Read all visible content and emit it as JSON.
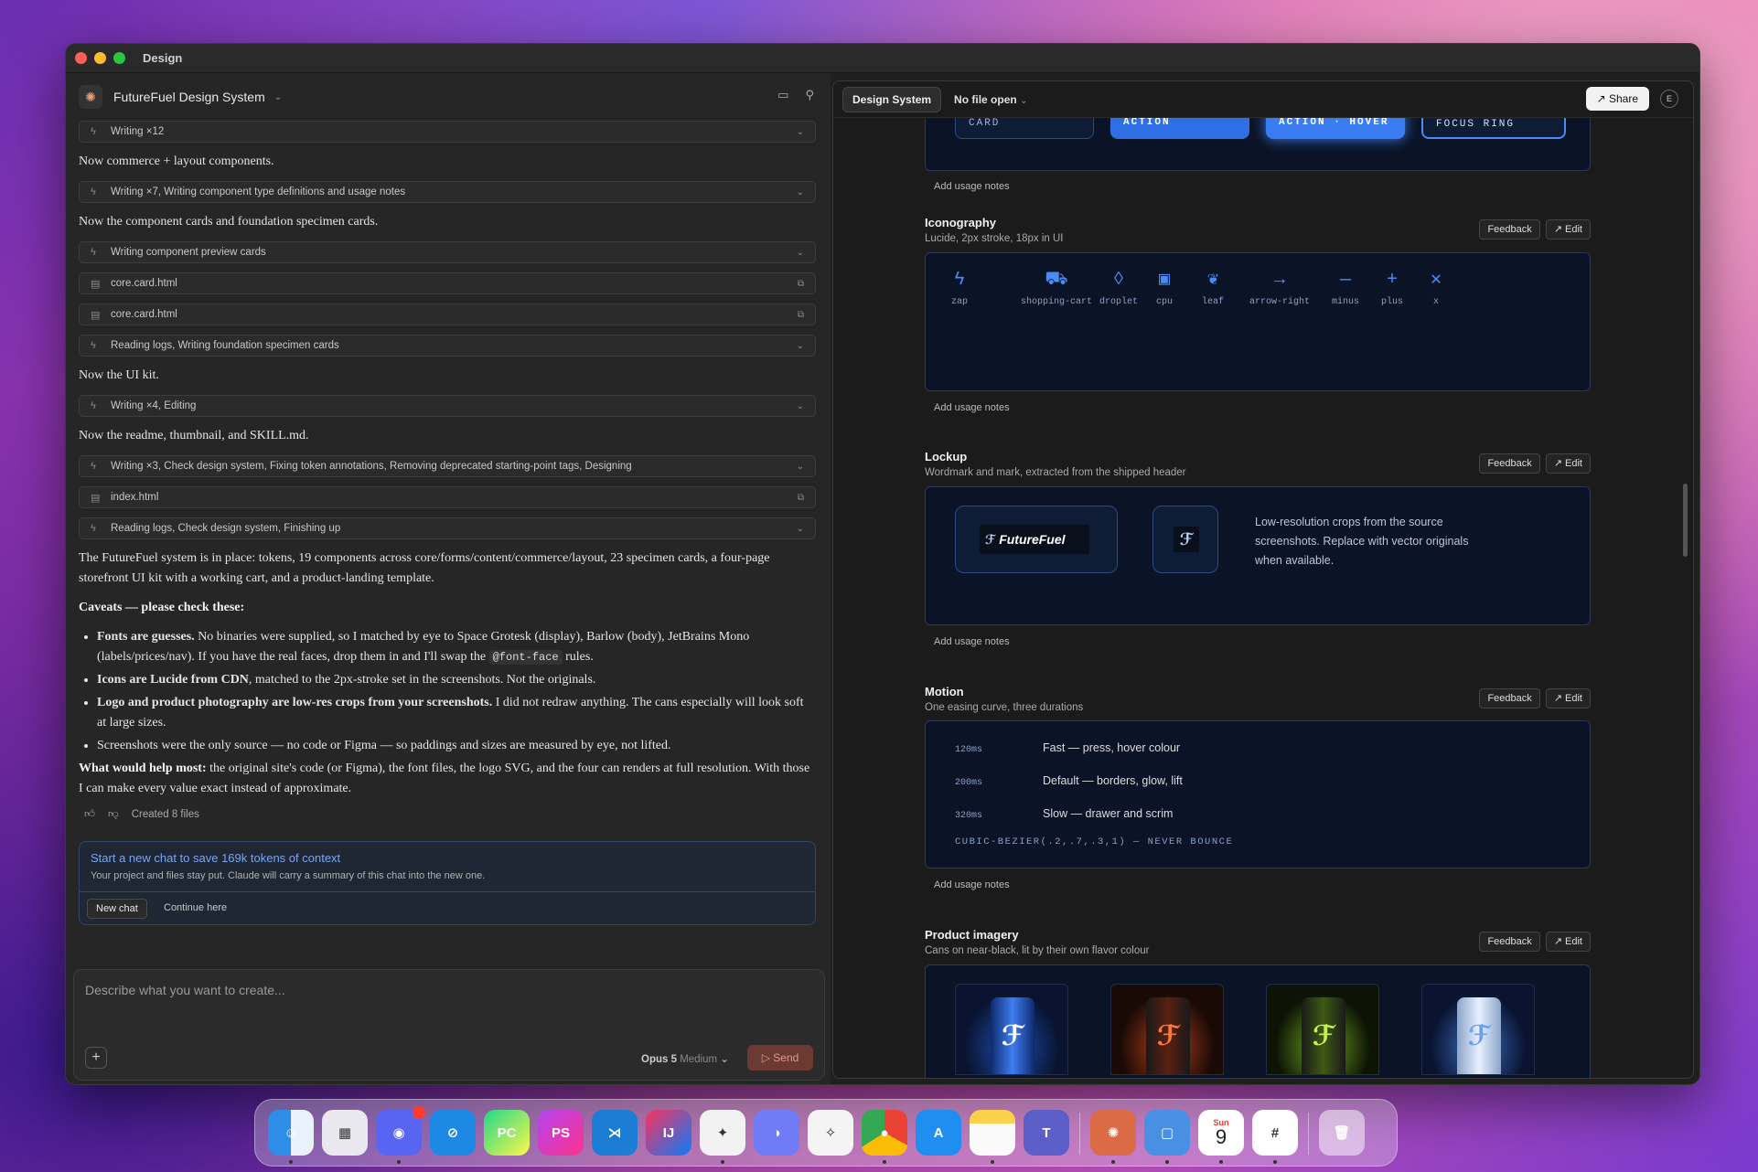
{
  "window_title": "Design",
  "project": {
    "name": "FutureFuel Design System"
  },
  "chat_items": [
    {
      "kind": "tool",
      "text": "Writing ×12"
    },
    {
      "kind": "msg",
      "text": "Now commerce + layout components."
    },
    {
      "kind": "tool",
      "text": "Writing ×7, Writing component type definitions and usage notes"
    },
    {
      "kind": "msg",
      "text": "Now the component cards and foundation specimen cards."
    },
    {
      "kind": "tool",
      "text": "Writing component preview cards"
    },
    {
      "kind": "file",
      "text": "core.card.html"
    },
    {
      "kind": "file",
      "text": "core.card.html"
    },
    {
      "kind": "tool",
      "text": "Reading logs, Writing foundation specimen cards"
    },
    {
      "kind": "msg",
      "text": "Now the UI kit."
    },
    {
      "kind": "tool",
      "text": "Writing ×4, Editing"
    },
    {
      "kind": "msg",
      "text": "Now the readme, thumbnail, and SKILL.md."
    },
    {
      "kind": "tool",
      "text": "Writing ×3, Check design system, Fixing token annotations, Removing deprecated starting-point tags, Designing"
    },
    {
      "kind": "file",
      "text": "index.html"
    },
    {
      "kind": "tool",
      "text": "Reading logs, Check design system, Finishing up"
    }
  ],
  "summary": {
    "para1": "The FutureFuel system is in place: tokens, 19 components across core/forms/content/commerce/layout, 23 specimen cards, a four-page storefront UI kit with a working cart, and a product-landing template.",
    "caveats_title": "Caveats — please check these:",
    "bullets": [
      {
        "bold": "Fonts are guesses.",
        "text": " No binaries were supplied, so I matched by eye to Space Grotesk (display), Barlow (body), JetBrains Mono (labels/prices/nav). If you have the real faces, drop them in and I'll swap the ",
        "code": "@font-face",
        "tail": " rules."
      },
      {
        "bold": "Icons are Lucide from CDN",
        "text": ", matched to the 2px-stroke set in the screenshots. Not the originals.",
        "code": "",
        "tail": ""
      },
      {
        "bold": "Logo and product photography are low-res crops from your screenshots.",
        "text": " I did not redraw anything. The cans especially will look soft at large sizes.",
        "code": "",
        "tail": ""
      },
      {
        "bold": "",
        "text": "Screenshots were the only source — no code or Figma — so paddings and sizes are measured by eye, not lifted.",
        "code": "",
        "tail": ""
      }
    ],
    "help_bold": "What would help most:",
    "help_text": " the original site's code (or Figma), the font files, the logo SVG, and the four can renders at full resolution. With those I can make every value exact instead of approximate.",
    "created": "Created 8 files"
  },
  "new_chat": {
    "title": "Start a new chat to save 169k tokens of context",
    "subtitle": "Your project and files stay put. Claude will carry a summary of this chat into the new one.",
    "button": "New chat",
    "link": "Continue here"
  },
  "composer": {
    "placeholder": "Describe what you want to create...",
    "model": "Opus 5",
    "effort": "Medium",
    "send": "Send"
  },
  "right_header": {
    "tab": "Design System",
    "file": "No file open",
    "share": "Share",
    "avatar": "E"
  },
  "chips": [
    "CARD",
    "ACTION",
    "ACTION · HOVER",
    "FOCUS RING"
  ],
  "usage_note": "Add usage notes",
  "feedback": "Feedback",
  "edit": "Edit",
  "sections": {
    "iconography": {
      "title": "Iconography",
      "subtitle": "Lucide, 2px stroke, 18px in UI",
      "icons": [
        {
          "name": "zap",
          "glyph": "ϟ"
        },
        {
          "name": "shopping-cart",
          "glyph": "⛟"
        },
        {
          "name": "droplet",
          "glyph": "◊"
        },
        {
          "name": "cpu",
          "glyph": "▣"
        },
        {
          "name": "leaf",
          "glyph": "❦"
        },
        {
          "name": "arrow-right",
          "glyph": "→"
        },
        {
          "name": "minus",
          "glyph": "—"
        },
        {
          "name": "plus",
          "glyph": "+"
        },
        {
          "name": "x",
          "glyph": "✕"
        }
      ]
    },
    "lockup": {
      "title": "Lockup",
      "subtitle": "Wordmark and mark, extracted from the shipped header",
      "wordmark": "FutureFuel",
      "desc": "Low-resolution crops from the source screenshots. Replace with vector originals when available."
    },
    "motion": {
      "title": "Motion",
      "subtitle": "One easing curve, three durations",
      "rows": [
        {
          "ms": "120ms",
          "text": "Fast — press, hover colour"
        },
        {
          "ms": "200ms",
          "text": "Default — borders, glow, lift"
        },
        {
          "ms": "320ms",
          "text": "Slow — drawer and scrim"
        }
      ],
      "curve": "CUBIC-BEZIER(.2,.7,.3,1) — NEVER BOUNCE"
    },
    "imagery": {
      "title": "Product imagery",
      "subtitle": "Cans on near-black, lit by their own flavor colour"
    }
  },
  "colors": {
    "accent": "#2f6fe6",
    "panel": "#0b1426",
    "send_bg": "#6b3a32"
  },
  "dock": [
    "Finder",
    "Launchpad",
    "Discord",
    "Safari",
    "PyCharm",
    "PhpStorm",
    "VS Code",
    "IntelliJ IDEA",
    "Perplexity",
    "Messages",
    "Gemini",
    "Chrome",
    "App Store",
    "Notes",
    "Teams",
    "Claude",
    "Simulator",
    "Calendar",
    "Slack",
    "Trash"
  ],
  "calendar": {
    "day": "Sun",
    "date": "9"
  }
}
